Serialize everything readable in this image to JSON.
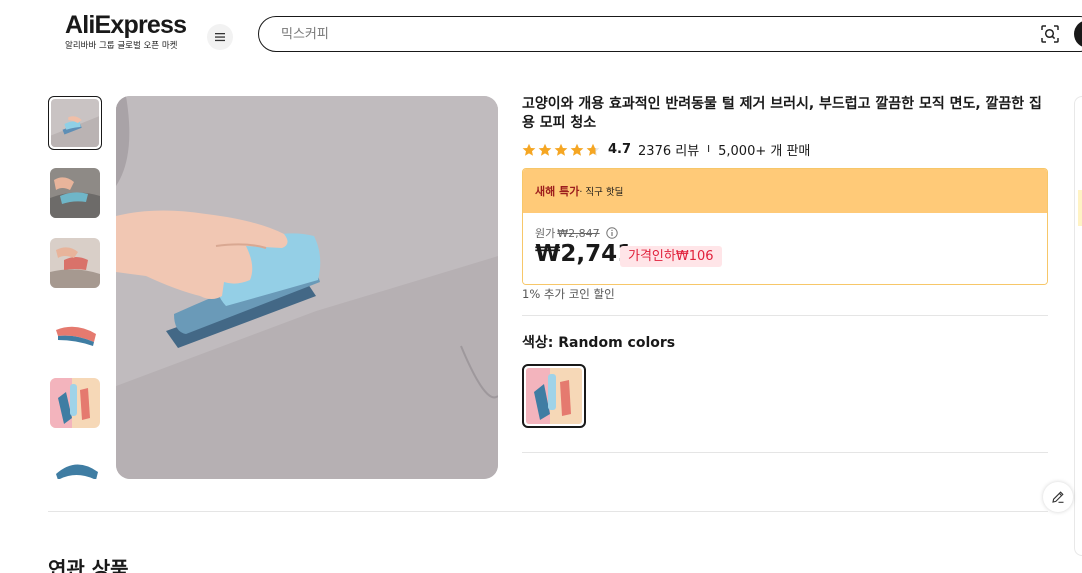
{
  "header": {
    "logo_text": "AliExpress",
    "logo_subtitle": "알리바바 그룹 글로벌 오픈 마켓",
    "search_placeholder": "믹스커피"
  },
  "product": {
    "title": "고양이와 개용 효과적인 반려동물 털 제거 브러시, 부드럽고 깔끔한 모직 면도, 깔끔한 집용 모피 청소",
    "rating": "4.7",
    "star_count": 5,
    "reviews": "2376 리뷰",
    "separator": "I",
    "sold": "5,000+ 개 판매",
    "deal": {
      "tag": "새해 특가",
      "subtitle": " · 직구 핫딜",
      "original_label": "원가",
      "original_price": "₩2,847",
      "price": "₩2,741",
      "discount_badge": "가격인하₩106"
    },
    "coin_discount": "1% 추가 코인 할인",
    "color_label": "색상: Random colors"
  },
  "section": {
    "related_title": "연관 상품"
  },
  "colors": {
    "accent_dark": "#191919",
    "deal_bg": "#ffca78",
    "deal_tag": "#9c1d1d",
    "discount_bg": "#ffe5e8",
    "discount_text": "#e1213b",
    "star": "#f5a623"
  },
  "icons": {
    "menu": "hamburger-icon",
    "camera": "camera-search-icon",
    "info": "info-icon",
    "edit": "pencil-icon",
    "star": "star-icon"
  }
}
